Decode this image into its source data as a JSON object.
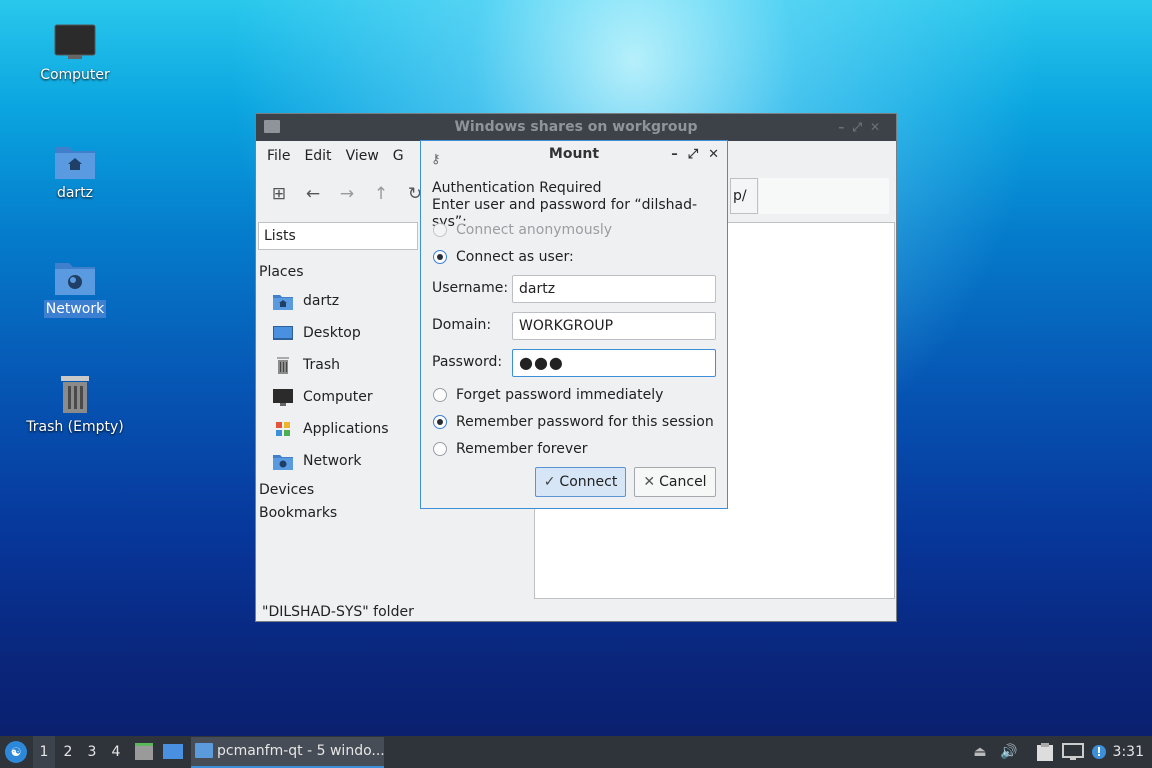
{
  "desktop": {
    "icons": [
      {
        "label": "Computer"
      },
      {
        "label": "dartz"
      },
      {
        "label": "Network"
      },
      {
        "label": "Trash (Empty)"
      }
    ]
  },
  "file_manager": {
    "title": "Windows shares on workgroup",
    "menu": [
      "File",
      "Edit",
      "View",
      "G"
    ],
    "path_fragment": "p/",
    "side_mode": "Lists",
    "places_header": "Places",
    "places": [
      {
        "label": "dartz",
        "icon": "home-folder-icon"
      },
      {
        "label": "Desktop",
        "icon": "desktop-icon"
      },
      {
        "label": "Trash",
        "icon": "trash-icon"
      },
      {
        "label": "Computer",
        "icon": "computer-icon"
      },
      {
        "label": "Applications",
        "icon": "applications-icon"
      },
      {
        "label": "Network",
        "icon": "network-icon"
      }
    ],
    "devices_header": "Devices",
    "bookmarks_header": "Bookmarks",
    "status": "\"DILSHAD-SYS\" folder"
  },
  "mount_dialog": {
    "title": "Mount",
    "heading": "Authentication Required",
    "prompt": "Enter user and password for “dilshad-sys”:",
    "connect_anonymously": "Connect anonymously",
    "connect_as_user": "Connect as user:",
    "username_label": "Username:",
    "username_value": "dartz",
    "domain_label": "Domain:",
    "domain_value": "WORKGROUP",
    "password_label": "Password:",
    "password_value": "●●●",
    "forget_password": "Forget password immediately",
    "remember_session": "Remember password for this session",
    "remember_forever": "Remember forever",
    "connect_button": "Connect",
    "cancel_button": "Cancel"
  },
  "taskbar": {
    "workspaces": [
      "1",
      "2",
      "3",
      "4"
    ],
    "task_label": "pcmanfm-qt - 5 windo...",
    "clock": "3:31"
  },
  "colors": {
    "accent": "#3d8fd8",
    "taskbar_bg": "#2f343b",
    "titlebar_bg": "#3d4148"
  }
}
